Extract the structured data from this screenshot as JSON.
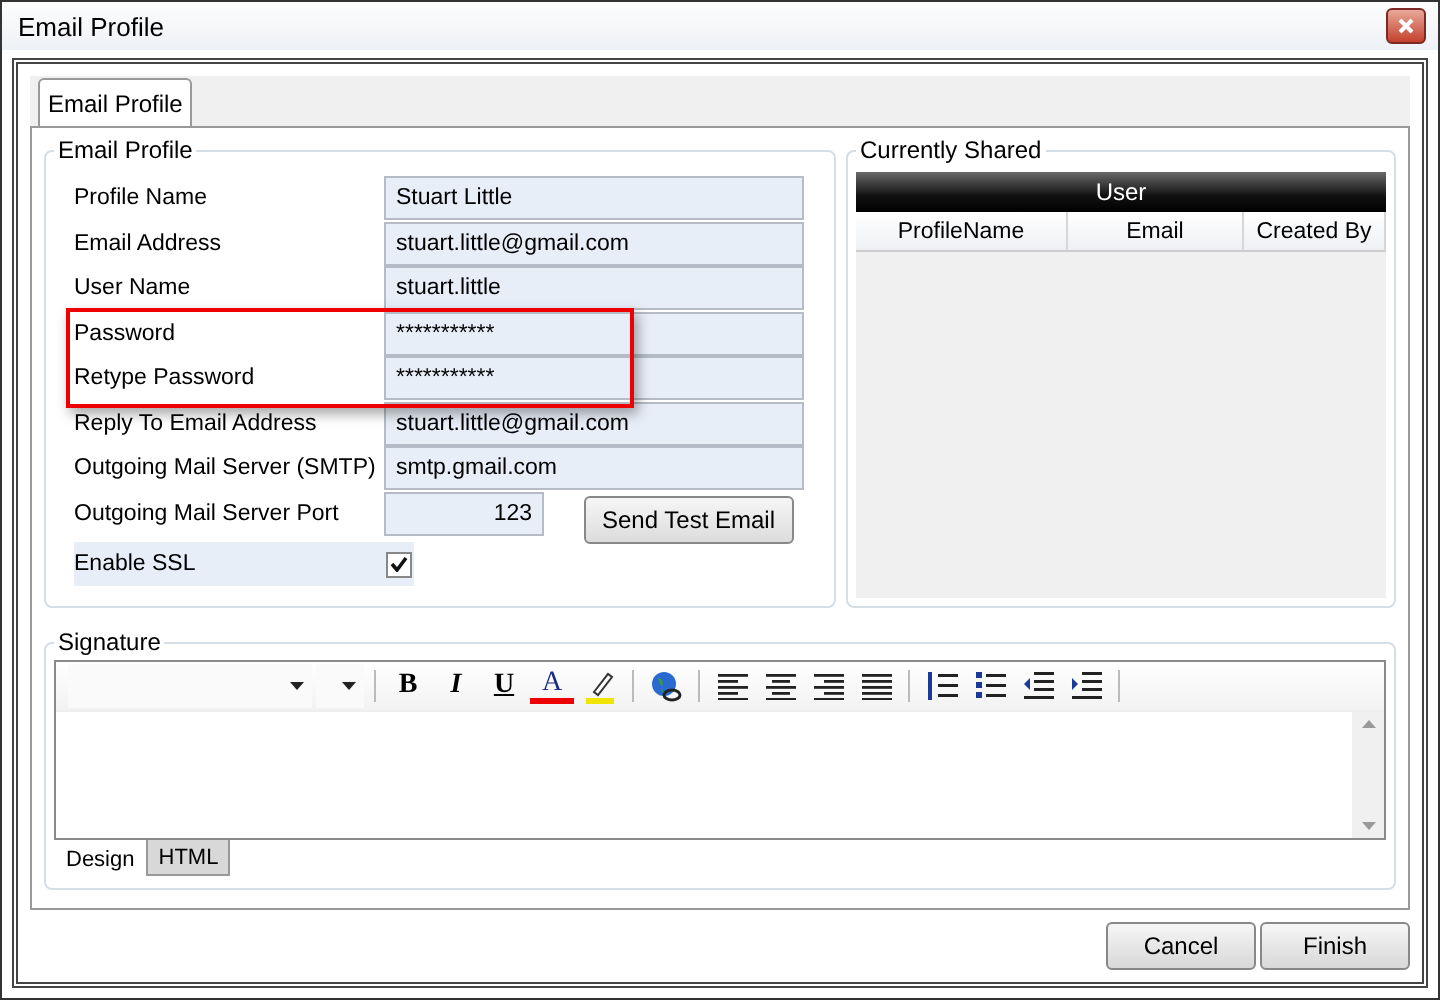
{
  "window": {
    "title": "Email Profile"
  },
  "tabs": [
    {
      "label": "Email Profile",
      "selected": true
    }
  ],
  "profile": {
    "title": "Email Profile",
    "fields": [
      {
        "label": "Profile Name",
        "value": "Stuart Little",
        "kind": "text",
        "highlighted": false
      },
      {
        "label": "Email Address",
        "value": "stuart.little@gmail.com",
        "kind": "text",
        "highlighted": false
      },
      {
        "label": "User Name",
        "value": "stuart.little",
        "kind": "text",
        "highlighted": false
      },
      {
        "label": "Password",
        "value": "***********",
        "kind": "text",
        "highlighted": true
      },
      {
        "label": "Retype Password",
        "value": "***********",
        "kind": "text",
        "highlighted": true
      },
      {
        "label": "Reply To Email Address",
        "value": "stuart.little@gmail.com",
        "kind": "text",
        "highlighted": false
      },
      {
        "label": "Outgoing Mail Server (SMTP)",
        "value": "smtp.gmail.com",
        "kind": "text",
        "highlighted": false
      },
      {
        "label": "Outgoing Mail Server Port",
        "value": "123",
        "kind": "number",
        "highlighted": false
      }
    ],
    "send_button": "Send Test Email",
    "ssl": {
      "label": "Enable SSL",
      "checked": true
    }
  },
  "shared": {
    "title": "Currently Shared",
    "group_header": "User",
    "columns": [
      "ProfileName",
      "Email",
      "Created By"
    ]
  },
  "signature": {
    "title": "Signature",
    "format_buttons": [
      {
        "kind": "bold",
        "label": "B"
      },
      {
        "kind": "italic",
        "label": "I"
      },
      {
        "kind": "underline",
        "label": "U"
      },
      {
        "kind": "font-color",
        "label": "A"
      }
    ],
    "view_tabs": [
      {
        "label": "Design",
        "selected": true
      },
      {
        "label": "HTML",
        "selected": false
      }
    ]
  },
  "buttons": [
    "Cancel",
    "Finish"
  ]
}
